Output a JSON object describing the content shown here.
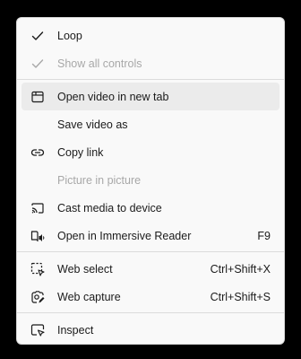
{
  "menu": {
    "loop": {
      "label": "Loop",
      "icon": "checkmark-icon"
    },
    "show_all_controls": {
      "label": "Show all controls",
      "icon": "checkmark-icon"
    },
    "open_new_tab": {
      "label": "Open video in new tab",
      "icon": "new-tab-icon"
    },
    "save_video": {
      "label": "Save video as"
    },
    "copy_link": {
      "label": "Copy link",
      "icon": "link-icon"
    },
    "picture_in_picture": {
      "label": "Picture in picture"
    },
    "cast": {
      "label": "Cast media to device",
      "icon": "cast-icon"
    },
    "immersive_reader": {
      "label": "Open in Immersive Reader",
      "shortcut": "F9",
      "icon": "immersive-reader-icon"
    },
    "web_select": {
      "label": "Web select",
      "shortcut": "Ctrl+Shift+X",
      "icon": "web-select-icon"
    },
    "web_capture": {
      "label": "Web capture",
      "shortcut": "Ctrl+Shift+S",
      "icon": "web-capture-icon"
    },
    "inspect": {
      "label": "Inspect",
      "icon": "inspect-icon"
    }
  },
  "colors": {
    "background": "#000000",
    "menu_bg": "#f9f9f9",
    "highlight": "#ebebeb",
    "text": "#1b1b1b",
    "disabled_text": "#a8a8a8"
  }
}
